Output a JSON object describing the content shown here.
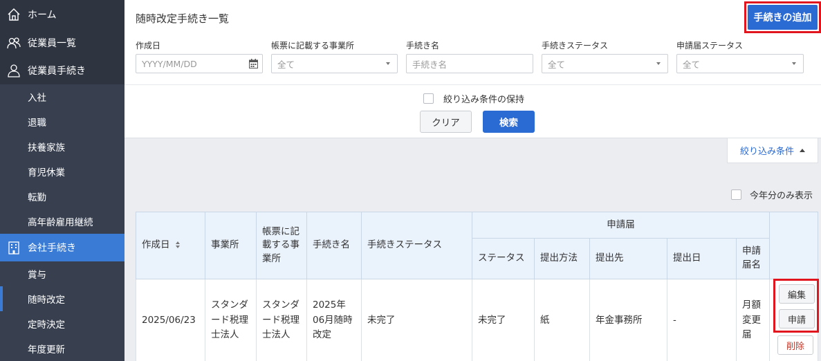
{
  "sidebar": {
    "items": [
      {
        "label": "ホーム",
        "icon": "home-icon"
      },
      {
        "label": "従業員一覧",
        "icon": "users-icon"
      },
      {
        "label": "従業員手続き",
        "icon": "user-icon"
      }
    ],
    "employee_subitems": [
      "入社",
      "退職",
      "扶養家族",
      "育児休業",
      "転勤",
      "高年齢雇用継続"
    ],
    "company": {
      "label": "会社手続き",
      "icon": "building-icon"
    },
    "company_subitems": [
      "賞与",
      "随時改定",
      "定時決定",
      "年度更新"
    ]
  },
  "header": {
    "title": "随時改定手続き一覧",
    "add_button": "手続きの追加"
  },
  "filters": {
    "created_label": "作成日",
    "created_placeholder": "YYYY/MM/DD",
    "office_label": "帳票に記載する事業所",
    "office_value": "全て",
    "name_label": "手続き名",
    "name_placeholder": "手続き名",
    "status_label": "手続きステータス",
    "status_value": "全て",
    "app_status_label": "申請届ステータス",
    "app_status_value": "全て",
    "keep_label": "絞り込み条件の保持",
    "clear_button": "クリア",
    "search_button": "検索",
    "toggle_label": "絞り込み条件",
    "this_year_label": "今年分のみ表示"
  },
  "table": {
    "headers": {
      "created": "作成日",
      "office": "事業所",
      "form_office": "帳票に記載する事業所",
      "name": "手続き名",
      "status": "手続きステータス",
      "application": "申請届",
      "app_status": "ステータス",
      "method": "提出方法",
      "dest": "提出先",
      "date": "提出日",
      "app_name": "申請届名"
    },
    "rows": [
      {
        "created": "2025/06/23",
        "office": "スタンダード税理士法人",
        "form_office": "スタンダード税理士法人",
        "name": "2025年06月随時改定",
        "status": "未完了",
        "app_status": "未完了",
        "method": "紙",
        "dest": "年金事務所",
        "date": "-",
        "app_name": "月額変更届",
        "edit": "編集",
        "apply": "申請",
        "delete": "削除"
      }
    ]
  }
}
